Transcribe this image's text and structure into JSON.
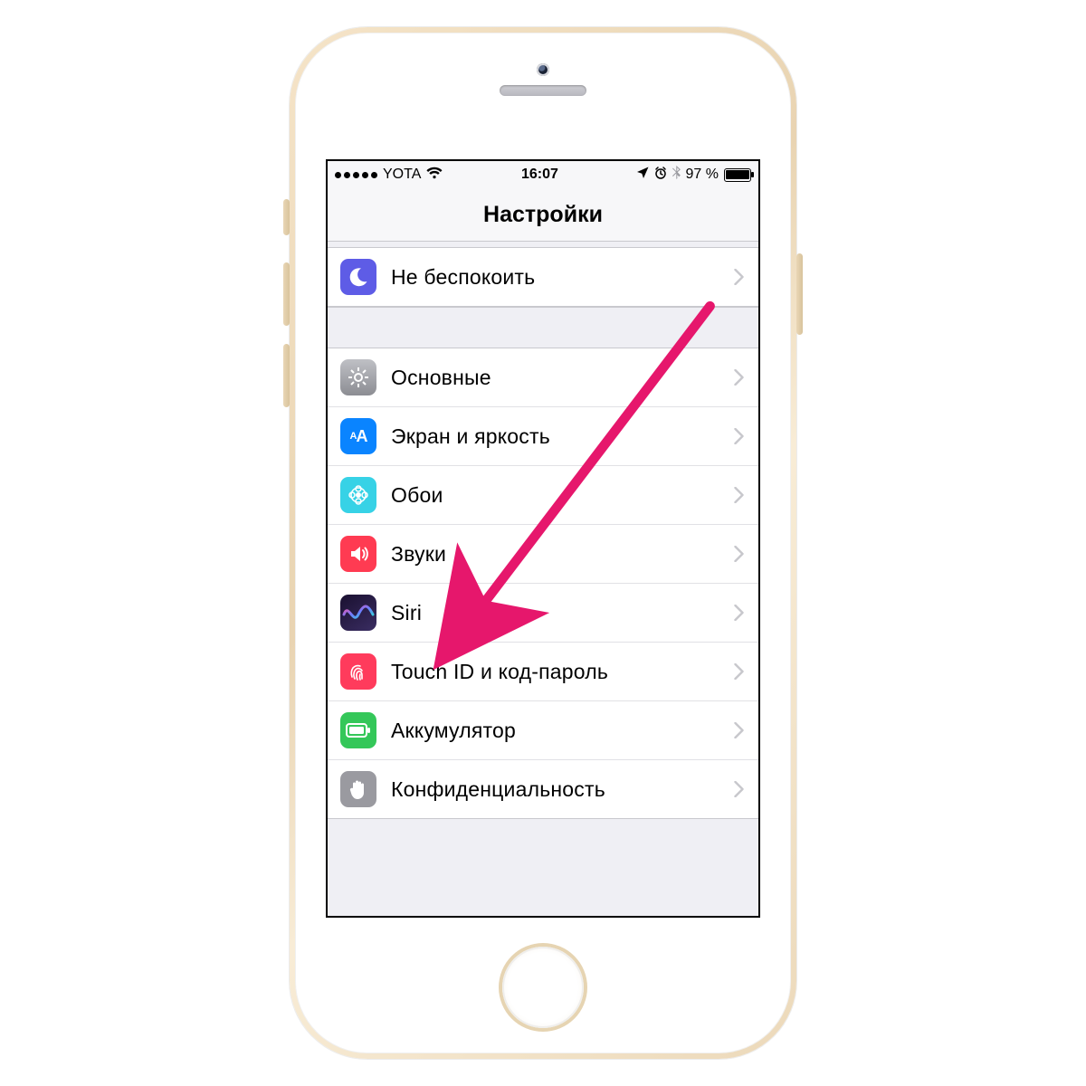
{
  "statusbar": {
    "carrier": "YOTA",
    "time": "16:07",
    "battery_text": "97 %",
    "icons": {
      "wifi": "wifi-icon",
      "location": "location-icon",
      "alarm": "alarm-icon",
      "bluetooth": "bluetooth-icon"
    }
  },
  "navbar": {
    "title": "Настройки"
  },
  "group1": {
    "items": [
      {
        "label": "Не беспокоить",
        "icon": "moon-icon"
      }
    ]
  },
  "group2": {
    "items": [
      {
        "label": "Основные",
        "icon": "gear-icon"
      },
      {
        "label": "Экран и яркость",
        "icon": "display-icon"
      },
      {
        "label": "Обои",
        "icon": "wallpaper-icon"
      },
      {
        "label": "Звуки",
        "icon": "sounds-icon"
      },
      {
        "label": "Siri",
        "icon": "siri-icon"
      },
      {
        "label": "Touch ID и код-пароль",
        "icon": "fingerprint-icon"
      },
      {
        "label": "Аккумулятор",
        "icon": "battery-icon"
      },
      {
        "label": "Конфиденциальность",
        "icon": "hand-icon"
      }
    ]
  },
  "annotation": {
    "arrow_color": "#e6176c"
  }
}
